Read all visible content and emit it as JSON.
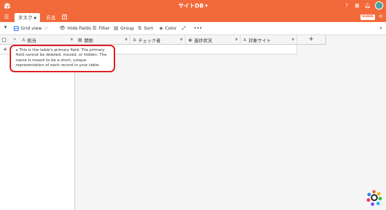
{
  "topbar": {
    "title": "サイトDB",
    "bg_color": "#f2693a"
  },
  "tabs": [
    {
      "label": "タスク",
      "active": true
    },
    {
      "label": "氏名",
      "active": false
    }
  ],
  "share_label": "SHARE",
  "toolbar": {
    "view_label": "Grid view",
    "hide_fields": "Hide fields",
    "filter": "Filter",
    "group": "Group",
    "sort": "Sort",
    "color": "Color"
  },
  "columns": [
    {
      "label": "担当",
      "icon": "text-icon"
    },
    {
      "label": "期限",
      "icon": "calendar-icon"
    },
    {
      "label": "チェック者",
      "icon": "text-icon"
    },
    {
      "label": "進捗状況",
      "icon": "status-icon"
    },
    {
      "label": "対象サイト",
      "icon": "text-icon"
    }
  ],
  "tooltip": {
    "text": "This is the table's primary field. The primary field cannot be deleted, moved, or hidden. The name is meant to be a short, unique representation of each record in your table."
  },
  "colors": {
    "accent": "#f2693a",
    "highlight_border": "#e0191f",
    "grid_view_icon": "#2d7ff9"
  }
}
